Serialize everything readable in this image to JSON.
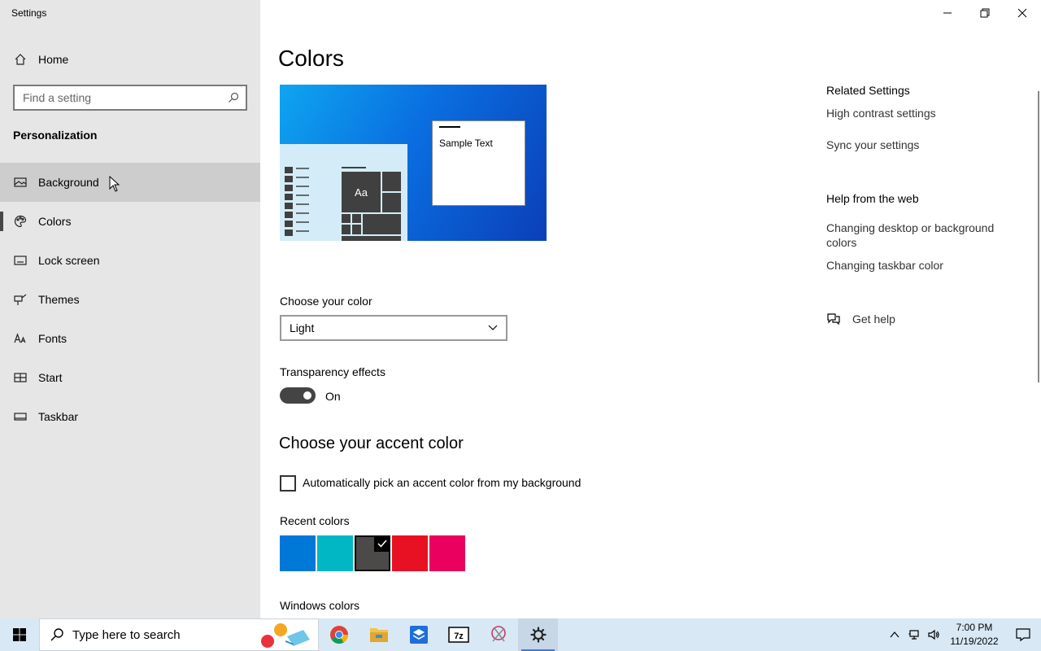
{
  "window": {
    "title": "Settings"
  },
  "sidebar": {
    "home_label": "Home",
    "search_placeholder": "Find a setting",
    "section_heading": "Personalization",
    "items": [
      {
        "label": "Background",
        "icon": "picture-icon"
      },
      {
        "label": "Colors",
        "icon": "palette-icon"
      },
      {
        "label": "Lock screen",
        "icon": "lock-screen-icon"
      },
      {
        "label": "Themes",
        "icon": "brush-icon"
      },
      {
        "label": "Fonts",
        "icon": "font-icon"
      },
      {
        "label": "Start",
        "icon": "start-icon"
      },
      {
        "label": "Taskbar",
        "icon": "taskbar-icon"
      }
    ],
    "selected": "Colors",
    "hovered": "Background"
  },
  "main": {
    "title": "Colors",
    "preview": {
      "sample_text": "Sample Text",
      "tile_text": "Aa"
    },
    "choose_color": {
      "label": "Choose your color",
      "value": "Light"
    },
    "transparency": {
      "label": "Transparency effects",
      "state": "On"
    },
    "accent": {
      "title": "Choose your accent color",
      "auto_pick_label": "Automatically pick an accent color from my background",
      "auto_pick_checked": false,
      "recent_label": "Recent colors",
      "recent_colors": [
        "#0078d7",
        "#00b7c3",
        "#4c4a48",
        "#e81123",
        "#ea005e"
      ],
      "selected_color": "#4c4a48",
      "windows_colors_label": "Windows colors"
    }
  },
  "related": {
    "heading": "Related Settings",
    "links": [
      "High contrast settings",
      "Sync your settings"
    ],
    "help_heading": "Help from the web",
    "help_links": [
      "Changing desktop or background colors",
      "Changing taskbar color"
    ],
    "get_help": "Get help"
  },
  "taskbar": {
    "search_placeholder": "Type here to search",
    "apps": [
      "chrome-icon",
      "file-explorer-icon",
      "stack-app-icon",
      "7zip-icon",
      "snipping-tool-icon",
      "settings-gear-icon"
    ],
    "time": "7:00 PM",
    "date": "11/19/2022"
  }
}
